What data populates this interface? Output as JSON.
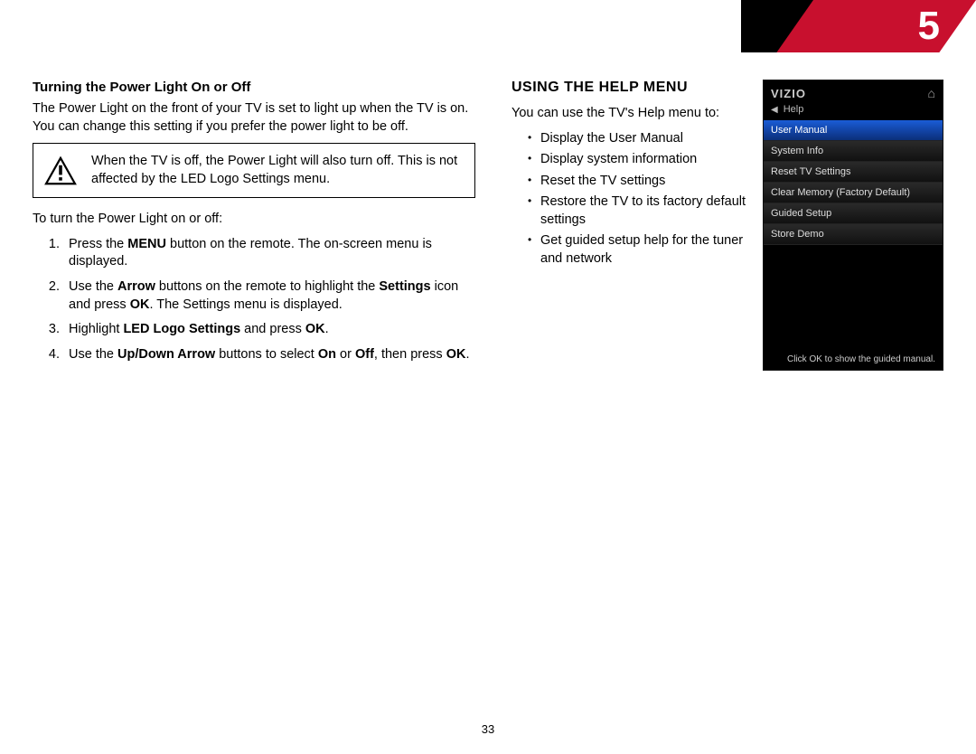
{
  "chapter_number": "5",
  "page_number": "33",
  "left": {
    "heading": "Turning the Power Light On or Off",
    "intro": "The Power Light on the front of your TV is set to light up when the TV is on. You can change this setting if you prefer the power light to be off.",
    "notice": "When the TV is off, the Power Light will also turn off. This is not affected by the LED Logo Settings menu.",
    "lead": "To turn the Power Light on or off:",
    "steps": {
      "s1a": "Press the ",
      "s1b": "MENU",
      "s1c": " button on the remote. The on-screen menu is displayed.",
      "s2a": "Use the ",
      "s2b": "Arrow",
      "s2c": " buttons on the remote to highlight the ",
      "s2d": "Settings",
      "s2e": " icon and press ",
      "s2f": "OK",
      "s2g": ". The Settings menu is displayed.",
      "s3a": "Highlight ",
      "s3b": "LED Logo Settings",
      "s3c": " and press ",
      "s3d": "OK",
      "s3e": ".",
      "s4a": "Use the ",
      "s4b": "Up/Down Arrow",
      "s4c": " buttons to select ",
      "s4d": "On",
      "s4e": " or ",
      "s4f": "Off",
      "s4g": ", then press ",
      "s4h": "OK",
      "s4i": "."
    }
  },
  "right": {
    "heading": "USING THE HELP MENU",
    "intro": "You can use the TV's Help menu to:",
    "bullets": [
      "Display the User Manual",
      "Display system information",
      "Reset the TV settings",
      "Restore the TV to its factory default settings",
      "Get guided setup help for the tuner and network"
    ]
  },
  "tv": {
    "logo": "VIZIO",
    "breadcrumb": "Help",
    "items": [
      "User Manual",
      "System Info",
      "Reset TV Settings",
      "Clear Memory (Factory Default)",
      "Guided Setup",
      "Store Demo"
    ],
    "footer": "Click OK to show the guided manual."
  }
}
